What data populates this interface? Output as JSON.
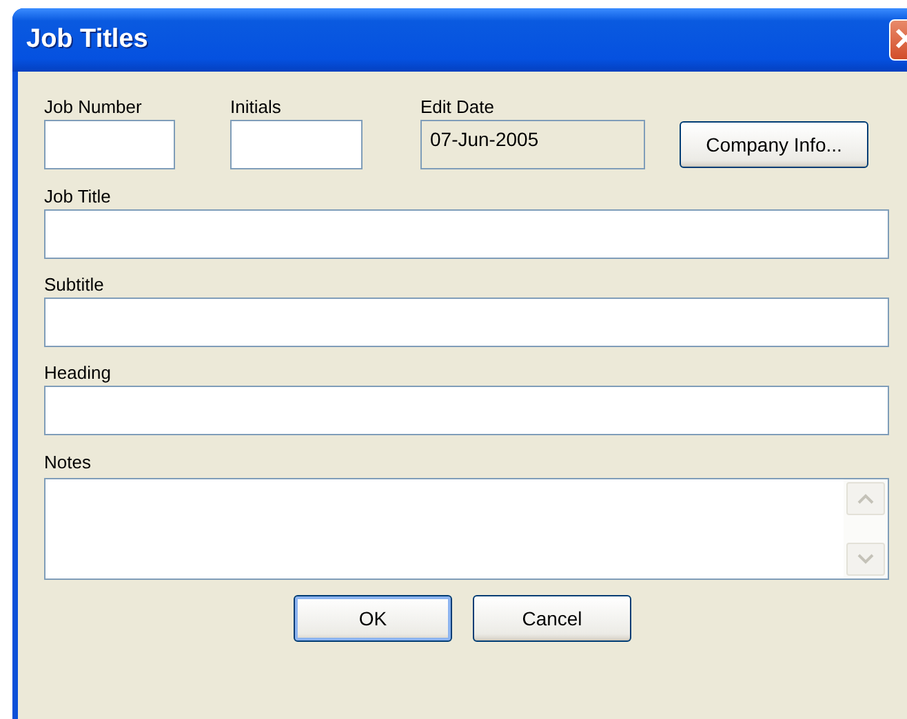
{
  "window": {
    "title": "Job Titles"
  },
  "top_fields": [
    {
      "label": "Job Number",
      "readonly": false
    },
    {
      "label": "Initials",
      "readonly": false
    },
    {
      "label": "Edit Date",
      "value": "07-Jun-2005",
      "readonly": true
    }
  ],
  "company_button": "Company Info...",
  "fields": [
    {
      "label": "Job Title"
    },
    {
      "label": "Subtitle"
    },
    {
      "label": "Heading"
    }
  ],
  "notes": {
    "label": "Notes"
  },
  "buttons": [
    {
      "label": "OK",
      "default": true
    },
    {
      "label": "Cancel",
      "default": false
    }
  ]
}
